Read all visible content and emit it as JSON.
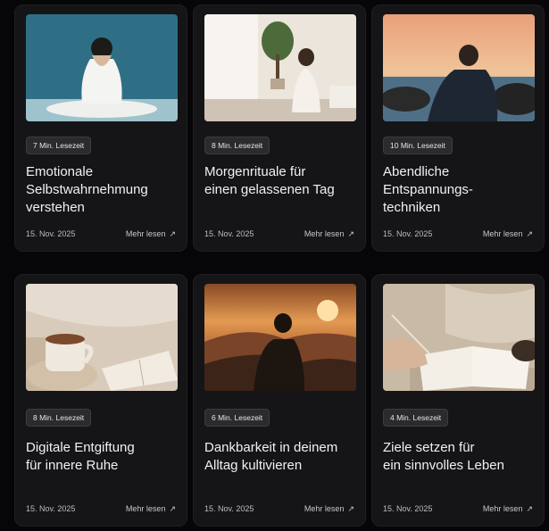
{
  "cards": [
    {
      "read_time": "7 Min. Lesezeit",
      "title": "Emotionale\nSelbstwahrnehmung\nverstehen",
      "date": "15. Nov. 2025",
      "more": "Mehr lesen",
      "arrow": "↗"
    },
    {
      "read_time": "8 Min. Lesezeit",
      "title": "Morgenrituale für\neinen gelassenen Tag",
      "date": "15. Nov. 2025",
      "more": "Mehr lesen",
      "arrow": "↗"
    },
    {
      "read_time": "10 Min. Lesezeit",
      "title": "Abendliche Entspannungs-\ntechniken",
      "date": "15. Nov. 2025",
      "more": "Mehr lesen",
      "arrow": "↗"
    },
    {
      "read_time": "8 Min. Lesezeit",
      "title": "Digitale Entgiftung\nfür innere Ruhe",
      "date": "15. Nov. 2025",
      "more": "Mehr lesen",
      "arrow": "↗"
    },
    {
      "read_time": "6 Min. Lesezeit",
      "title": "Dankbarkeit in deinem\nAlltag kultivieren",
      "date": "15. Nov. 2025",
      "more": "Mehr lesen",
      "arrow": "↗"
    },
    {
      "read_time": "4 Min. Lesezeit",
      "title": "Ziele setzen für\nein sinnvolles Leben",
      "date": "15. Nov. 2025",
      "more": "Mehr lesen",
      "arrow": "↗"
    }
  ]
}
